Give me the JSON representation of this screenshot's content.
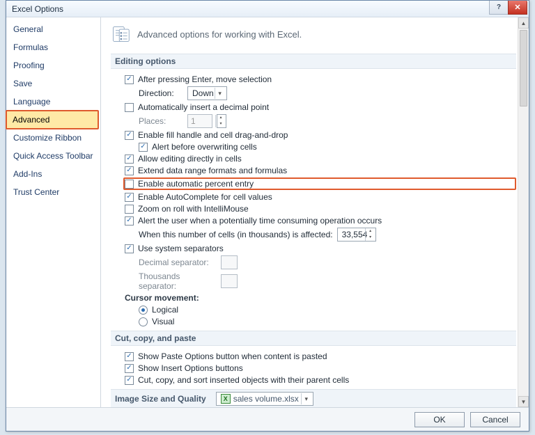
{
  "window": {
    "title": "Excel Options"
  },
  "sidebar": {
    "items": [
      {
        "label": "General"
      },
      {
        "label": "Formulas"
      },
      {
        "label": "Proofing"
      },
      {
        "label": "Save"
      },
      {
        "label": "Language"
      },
      {
        "label": "Advanced",
        "selected": true
      },
      {
        "label": "Customize Ribbon"
      },
      {
        "label": "Quick Access Toolbar"
      },
      {
        "label": "Add-Ins"
      },
      {
        "label": "Trust Center"
      }
    ]
  },
  "heading": "Advanced options for working with Excel.",
  "sections": {
    "editing": {
      "title": "Editing options",
      "after_enter": "After pressing Enter, move selection",
      "direction_label": "Direction:",
      "direction_value": "Down",
      "auto_decimal": "Automatically insert a decimal point",
      "places_label": "Places:",
      "places_value": "1",
      "fill_handle": "Enable fill handle and cell drag-and-drop",
      "alert_overwrite": "Alert before overwriting cells",
      "allow_edit": "Allow editing directly in cells",
      "extend_range": "Extend data range formats and formulas",
      "auto_percent": "Enable automatic percent entry",
      "autocomplete": "Enable AutoComplete for cell values",
      "zoom_intelli": "Zoom on roll with IntelliMouse",
      "alert_time": "Alert the user when a potentially time consuming operation occurs",
      "num_cells_label": "When this number of cells (in thousands) is affected:",
      "num_cells_value": "33,554",
      "sys_sep": "Use system separators",
      "dec_sep_label": "Decimal separator:",
      "dec_sep_value": ".",
      "tho_sep_label": "Thousands separator:",
      "tho_sep_value": ",",
      "cursor_label": "Cursor movement:",
      "cursor_logical": "Logical",
      "cursor_visual": "Visual"
    },
    "ccp": {
      "title": "Cut, copy, and paste",
      "show_paste": "Show Paste Options button when content is pasted",
      "show_insert": "Show Insert Options buttons",
      "ccp_objects": "Cut, copy, and sort inserted objects with their parent cells"
    },
    "isq": {
      "title": "Image Size and Quality",
      "file": "sales volume.xlsx"
    }
  },
  "footer": {
    "ok": "OK",
    "cancel": "Cancel"
  }
}
